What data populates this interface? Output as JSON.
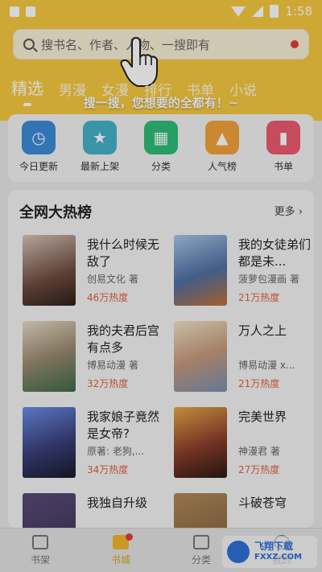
{
  "status": {
    "time": "1:58"
  },
  "search": {
    "placeholder": "搜书名、作者、人物、一搜即有"
  },
  "tabs": [
    "精选",
    "男漫",
    "女漫",
    "排行",
    "书单",
    "小说"
  ],
  "tip": "搜一搜，您想要的全都有！~",
  "quick": [
    {
      "label": "今日更新",
      "icon": "clock-icon",
      "color": "#3d8bd8",
      "glyph": "◷"
    },
    {
      "label": "最新上架",
      "icon": "shelf-star-icon",
      "color": "#46b1c8",
      "glyph": "★"
    },
    {
      "label": "分类",
      "icon": "grid-icon",
      "color": "#2ebd78",
      "glyph": "▦"
    },
    {
      "label": "人气榜",
      "icon": "flame-icon",
      "color": "#f3a23a",
      "glyph": "▲"
    },
    {
      "label": "书单",
      "icon": "bookmark-icon",
      "color": "#ec5a6f",
      "glyph": "▮"
    }
  ],
  "rank": {
    "title": "全网大热榜",
    "more": "更多",
    "books": [
      {
        "title": "我什么时候无敌了",
        "author": "创易文化 著",
        "heat": "46万热度",
        "color": "#6d4b3f"
      },
      {
        "title": "我的女徒弟们都是未...",
        "author": "菠萝包漫画 著",
        "heat": "21万热度",
        "color": "#4e6fa3"
      },
      {
        "title": "我的夫君后宫有点多",
        "author": "博易动漫 著",
        "heat": "32万热度",
        "color": "#9a8a70"
      },
      {
        "title": "万人之上",
        "author": "博易动漫 x...",
        "heat": "21万热度",
        "color": "#c59a7a"
      },
      {
        "title": "我家娘子竟然是女帝?",
        "author": "原著: 老狗,...",
        "heat": "34万热度",
        "color": "#3a3f7a"
      },
      {
        "title": "完美世界",
        "author": "神漫君 著",
        "heat": "27万热度",
        "color": "#8a3d2a"
      },
      {
        "title": "我独自升级",
        "author": "",
        "heat": "",
        "color": "#3a3550"
      },
      {
        "title": "斗破苍穹",
        "author": "",
        "heat": "",
        "color": "#7a5a3a"
      }
    ]
  },
  "nav": [
    {
      "label": "书架",
      "icon": "bookshelf-icon"
    },
    {
      "label": "书城",
      "icon": "store-icon"
    },
    {
      "label": "分类",
      "icon": "category-icon"
    },
    {
      "label": "我的",
      "icon": "profile-icon"
    }
  ],
  "watermark": {
    "text1": "飞翔下载",
    "text2": "FXXZ.COM"
  }
}
